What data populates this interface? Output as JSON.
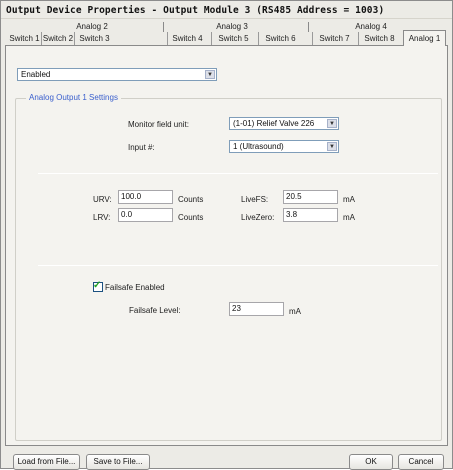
{
  "window": {
    "title": "Output Device Properties - Output Module 3 (RS485 Address = 1003)"
  },
  "tab_groups": [
    "Analog 2",
    "Analog 3",
    "Analog 4"
  ],
  "tabs": [
    "Switch 1",
    "Switch 2",
    "Switch 3",
    "Switch 4",
    "Switch 5",
    "Switch 6",
    "Switch 7",
    "Switch 8",
    "Analog 1"
  ],
  "active_tab": "Analog 1",
  "enable_select": {
    "value": "Enabled"
  },
  "group": {
    "title": "Analog Output 1 Settings",
    "monitor_field_unit": {
      "label": "Monitor field unit:",
      "value": "(1-01) Relief Valve 226"
    },
    "input_num": {
      "label": "Input #:",
      "value": "1 (Ultrasound)"
    }
  },
  "range": {
    "urv": {
      "label": "URV:",
      "value": "100.0",
      "unit": "Counts"
    },
    "lrv": {
      "label": "LRV:",
      "value": "0.0",
      "unit": "Counts"
    },
    "live_fs": {
      "label": "LiveFS:",
      "value": "20.5",
      "unit": "mA"
    },
    "live_zero": {
      "label": "LiveZero:",
      "value": "3.8",
      "unit": "mA"
    }
  },
  "failsafe": {
    "enabled_label": "Failsafe Enabled",
    "checked": true,
    "level_label": "Failsafe Level:",
    "level_value": "23",
    "level_unit": "mA"
  },
  "buttons": {
    "load": "Load from File...",
    "save": "Save to File...",
    "ok": "OK",
    "cancel": "Cancel"
  },
  "colors": {
    "group_title": "#3a5fcd",
    "checkmark": "#21a121",
    "dialog_bg": "#ecebe6",
    "panel_bg": "#f4f3ef"
  }
}
